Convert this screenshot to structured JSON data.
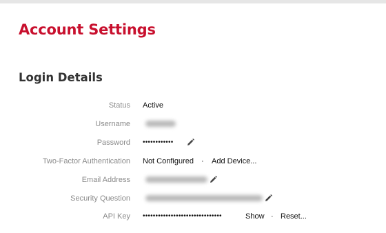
{
  "colors": {
    "accent": "#c8102e",
    "link": "#1a5ea7",
    "label": "#8a8a8a"
  },
  "page": {
    "title": "Account Settings"
  },
  "login": {
    "title": "Login Details",
    "status": {
      "label": "Status",
      "value": "Active"
    },
    "username": {
      "label": "Username",
      "value_state": "redacted"
    },
    "password": {
      "label": "Password",
      "value": "••••••••••••",
      "edit_icon": "pencil-icon"
    },
    "two_factor": {
      "label": "Two-Factor Authentication",
      "value": "Not Configured",
      "separator": "·",
      "add_label": "Add Device..."
    },
    "email": {
      "label": "Email Address",
      "value_state": "redacted",
      "edit_icon": "pencil-icon"
    },
    "security_question": {
      "label": "Security Question",
      "value_state": "redacted",
      "edit_icon": "pencil-icon"
    },
    "api_key": {
      "label": "API Key",
      "value": "•••••••••••••••••••••••••••••••",
      "show_label": "Show",
      "separator": "·",
      "reset_label": "Reset..."
    }
  }
}
